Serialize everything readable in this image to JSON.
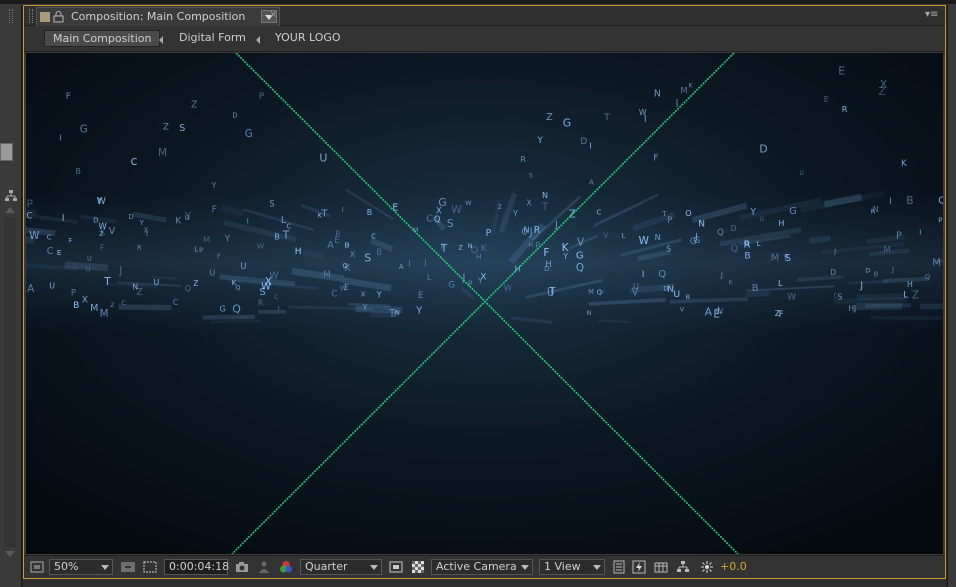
{
  "app": {
    "panel_tab_title": "Composition: Main Composition",
    "tab_close_glyph": "×",
    "panel_menu_glyph": "▾≡"
  },
  "breadcrumbs": [
    {
      "label": "Main Composition",
      "active": true
    },
    {
      "label": "Digital Form",
      "active": false
    },
    {
      "label": "YOUR LOGO",
      "active": false
    }
  ],
  "toolbar": {
    "magnification": "50%",
    "timecode": "0:00:04:18",
    "resolution": "Quarter",
    "view_camera": "Active Camera",
    "view_layout": "1 View",
    "exposure": "+0.0"
  },
  "colors": {
    "panel_border_accent": "#c89a32",
    "guide_line": "#21d67a",
    "particle_glow": "#8fc6ff",
    "exposure_text": "#d6a72c"
  },
  "icons": {
    "region_of_interest": "region-of-interest-icon",
    "snapshot": "camera-snapshot-icon",
    "show_snapshot": "show-snapshot-icon",
    "channels": "rgb-channels-icon",
    "fast_previews": "fast-previews-icon",
    "transparency_grid": "transparency-grid-icon",
    "timeline": "timeline-icon",
    "flowchart": "flowchart-icon",
    "reset_exposure": "reset-exposure-icon"
  }
}
